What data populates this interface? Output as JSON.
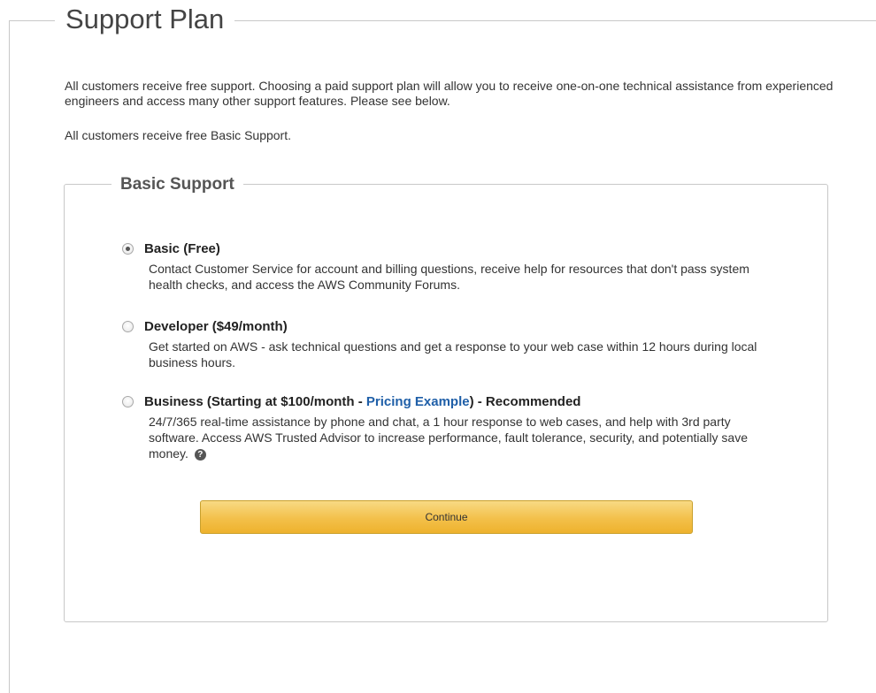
{
  "page": {
    "title": "Support Plan",
    "intro": "All customers receive free support. Choosing a paid support plan will allow you to receive one-on-one technical assistance from experienced engineers and access many other support features. Please see below.",
    "intro_free": "All customers receive free Basic Support."
  },
  "section": {
    "title": "Basic Support"
  },
  "options": [
    {
      "label": "Basic (Free)",
      "selected": true,
      "description": "Contact Customer Service for account and billing questions, receive help for resources that don't pass system health checks, and access the AWS Community Forums."
    },
    {
      "label": "Developer ($49/month)",
      "selected": false,
      "description": "Get started on AWS - ask technical questions and get a response to your web case within 12 hours during local business hours."
    },
    {
      "label_prefix": "Business (Starting at $100/month - ",
      "link_text": "Pricing Example",
      "label_suffix": ") - Recommended",
      "selected": false,
      "description": "24/7/365 real-time assistance by phone and chat, a 1 hour response to web cases, and help with 3rd party software. Access AWS Trusted Advisor to increase performance, fault tolerance, security, and potentially save money.",
      "help_icon_glyph": "?"
    }
  ],
  "actions": {
    "continue_label": "Continue"
  },
  "icons": {
    "help": "help-icon"
  },
  "colors": {
    "button_gradient_top": "#f8da84",
    "button_gradient_bottom": "#eeb22d",
    "link": "#1f5fa8"
  }
}
